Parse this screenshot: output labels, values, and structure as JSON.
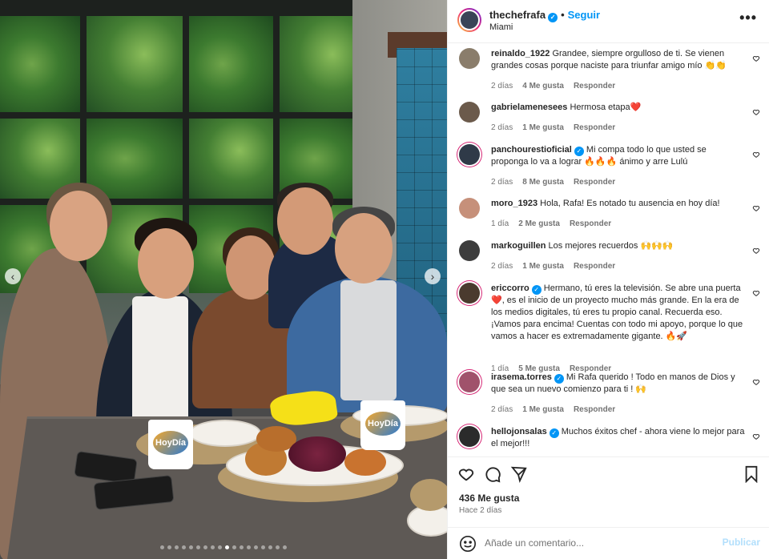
{
  "header": {
    "username": "thechefrafa",
    "follow_label": "Seguir",
    "separator": "•",
    "location": "Miami",
    "more_label": "•••"
  },
  "comments": [
    {
      "user": "reinaldo_1922",
      "verified": false,
      "text": "Grandee, siempre orgulloso de ti. Se vienen grandes cosas porque naciste para triunfar amigo mío 👏👏",
      "time": "2 días",
      "likes": "4 Me gusta",
      "reply": "Responder",
      "avatar_color": "#8a7d6b"
    },
    {
      "user": "gabrielamenesees",
      "verified": false,
      "text": "Hermosa etapa❤️",
      "time": "2 días",
      "likes": "1 Me gusta",
      "reply": "Responder",
      "avatar_color": "#6b5a4b"
    },
    {
      "user": "panchourestioficial",
      "verified": true,
      "text": "Mi compa todo lo que usted se proponga lo va a lograr 🔥🔥🔥 ánimo y arre Lulú",
      "time": "2 días",
      "likes": "8 Me gusta",
      "reply": "Responder",
      "avatar_color": "#2f3a48"
    },
    {
      "user": "moro_1923",
      "verified": false,
      "text": "Hola, Rafa! Es notado tu ausencia en hoy día!",
      "time": "1 día",
      "likes": "2 Me gusta",
      "reply": "Responder",
      "avatar_color": "#c6907a"
    },
    {
      "user": "markoguillen",
      "verified": false,
      "text": "Los mejores recuerdos 🙌🙌🙌",
      "time": "2 días",
      "likes": "1 Me gusta",
      "reply": "Responder",
      "avatar_color": "#3d3d3d"
    },
    {
      "user": "ericcorro",
      "verified": true,
      "text": "Hermano, tú eres la televisión. Se abre una puerta ❤️, es el inicio de un proyecto mucho más grande. En la era de los medios digitales, tú eres tu propio canal. Recuerda eso. ¡Vamos para encima! Cuentas con todo mi apoyo, porque lo que vamos a hacer es extremadamente gigante. 🔥🚀",
      "time": "1 día",
      "likes": "5 Me gusta",
      "reply": "Responder",
      "avatar_color": "#4a3a2e"
    },
    {
      "user": "irasema.torres",
      "verified": true,
      "text": "Mi Rafa querido ! Todo en manos de Dios y que sea un nuevo comienzo para ti ! 🙌",
      "time": "2 días",
      "likes": "1 Me gusta",
      "reply": "Responder",
      "avatar_color": "#a0526b"
    },
    {
      "user": "hellojonsalas",
      "verified": true,
      "text": "Muchos éxitos chef - ahora viene lo mejor para el mejor!!!",
      "time": "",
      "likes": "",
      "reply": "",
      "avatar_color": "#2b2b2b"
    }
  ],
  "actions": {
    "likes": "436 Me gusta",
    "date": "Hace 2 días"
  },
  "add_comment": {
    "placeholder": "Añade un comentario...",
    "publish_label": "Publicar"
  },
  "photo": {
    "mug_logo": "HoyDía",
    "carousel_total": 18,
    "carousel_active_index": 9
  },
  "colors": {
    "accent": "#0095f6",
    "muted_text": "#737373",
    "publish_disabled": "#b2dffc"
  }
}
